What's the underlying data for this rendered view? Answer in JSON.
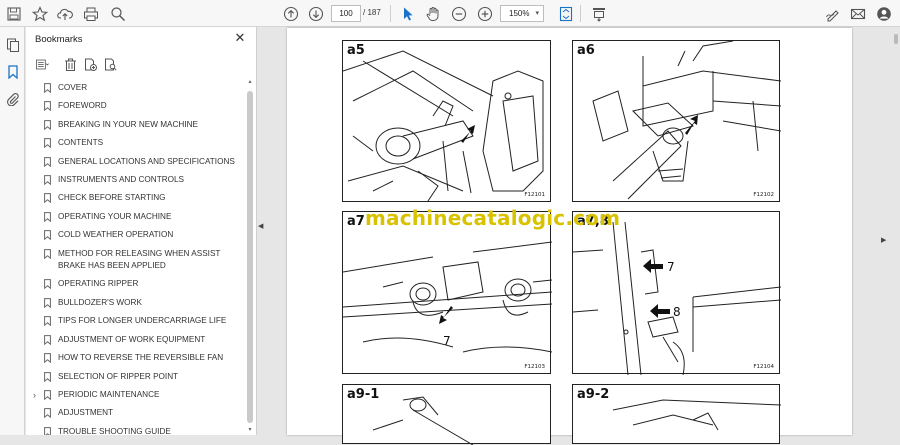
{
  "toolbar": {
    "page_current": "100",
    "page_total": "/ 187",
    "zoom": "150%"
  },
  "panel": {
    "title": "Bookmarks"
  },
  "bookmarks": [
    {
      "label": "COVER",
      "expandable": false
    },
    {
      "label": "FOREWORD",
      "expandable": false
    },
    {
      "label": "BREAKING IN YOUR NEW MACHINE",
      "expandable": false
    },
    {
      "label": "CONTENTS",
      "expandable": false
    },
    {
      "label": "GENERAL LOCATIONS AND SPECIFICATIONS",
      "expandable": false
    },
    {
      "label": "INSTRUMENTS AND CONTROLS",
      "expandable": false
    },
    {
      "label": "CHECK BEFORE STARTING",
      "expandable": false
    },
    {
      "label": "OPERATING YOUR MACHINE",
      "expandable": false
    },
    {
      "label": "COLD WEATHER OPERATION",
      "expandable": false
    },
    {
      "label": "METHOD FOR RELEASING WHEN ASSIST BRAKE HAS BEEN APPLIED",
      "expandable": false
    },
    {
      "label": "OPERATING RIPPER",
      "expandable": false
    },
    {
      "label": "BULLDOZER'S WORK",
      "expandable": false
    },
    {
      "label": "TIPS FOR LONGER UNDERCARRIAGE LIFE",
      "expandable": false
    },
    {
      "label": "ADJUSTMENT OF WORK EQUIPMENT",
      "expandable": false
    },
    {
      "label": "HOW TO REVERSE THE REVERSIBLE FAN",
      "expandable": false
    },
    {
      "label": "SELECTION OF RIPPER POINT",
      "expandable": false
    },
    {
      "label": "PERIODIC MAINTENANCE",
      "expandable": true
    },
    {
      "label": "ADJUSTMENT",
      "expandable": false
    },
    {
      "label": "TROUBLE SHOOTING GUIDE",
      "expandable": false
    }
  ],
  "document": {
    "watermark": "machinecatalogic.com",
    "figures": [
      {
        "label": "a5",
        "code": "F12101"
      },
      {
        "label": "a6",
        "code": "F12102"
      },
      {
        "label": "a7",
        "code": "F12103",
        "callout": "7"
      },
      {
        "label": "a7,8",
        "code": "F12104",
        "callout_a": "7",
        "callout_b": "8"
      },
      {
        "label": "a9-1",
        "code": ""
      },
      {
        "label": "a9-2",
        "code": ""
      }
    ]
  },
  "icons": [
    "save-icon",
    "bookmark-star-icon",
    "upload-icon",
    "print-icon",
    "zoom-search-icon",
    "page-up-icon",
    "page-down-icon",
    "select-cursor-icon",
    "hand-icon",
    "zoom-out-icon",
    "zoom-in-icon",
    "fit-page-icon",
    "scroll-mode-icon",
    "sign-icon",
    "email-icon",
    "account-icon",
    "thumbnails-icon",
    "bookmarks-icon",
    "attachments-icon"
  ]
}
